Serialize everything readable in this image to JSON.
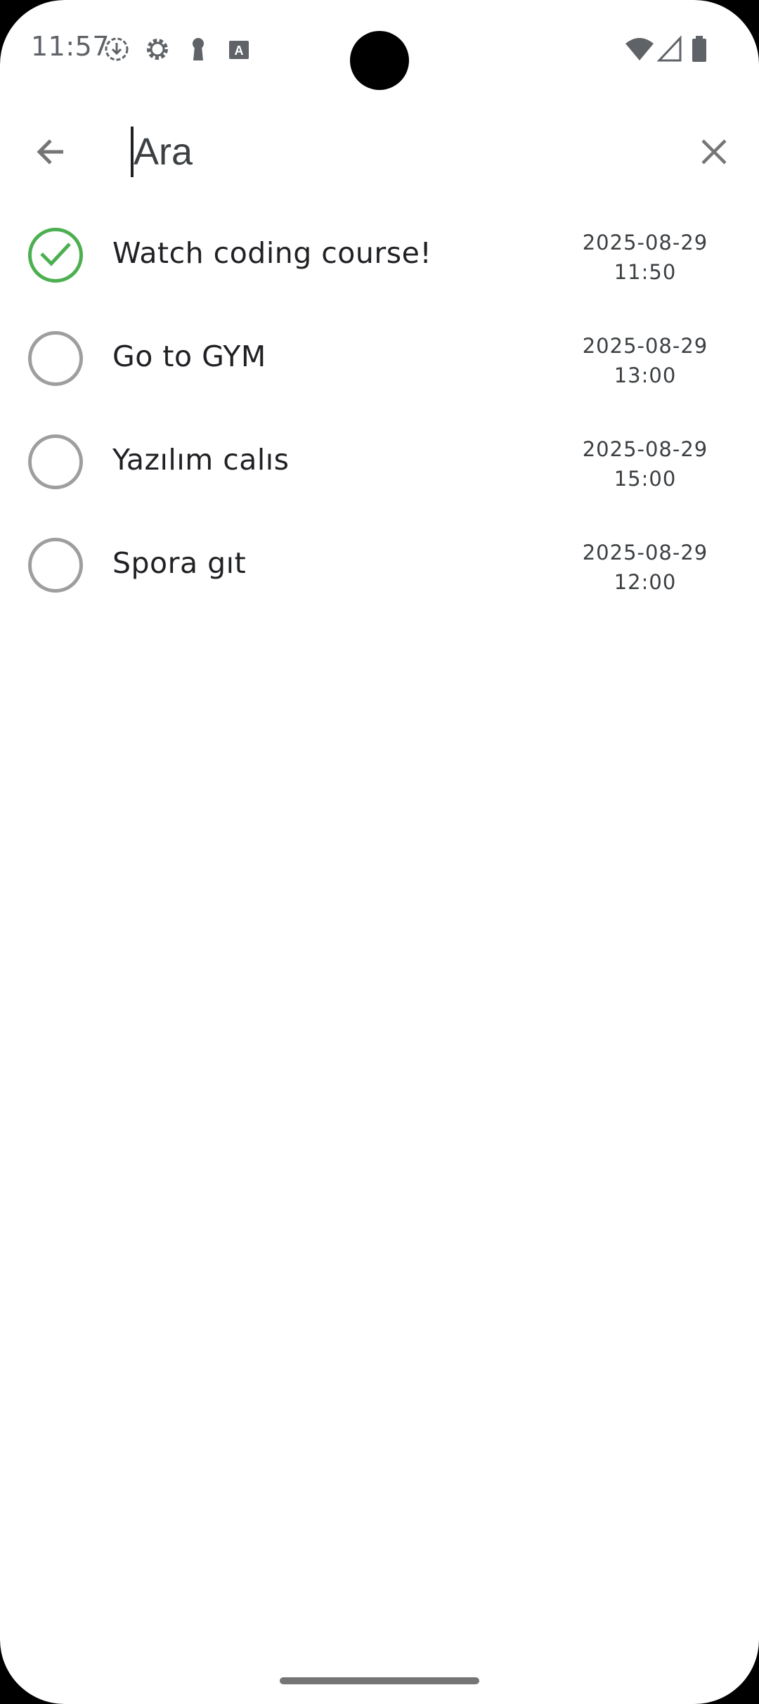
{
  "status_bar": {
    "time": "11:57",
    "icons": [
      "download-circle-icon",
      "settings-gear-icon",
      "keyhole-icon",
      "keyboard-a-icon",
      "wifi-icon",
      "signal-icon",
      "battery-icon"
    ]
  },
  "search": {
    "placeholder": "Ara",
    "value": "",
    "back_icon": "arrow-left-icon",
    "clear_icon": "close-icon"
  },
  "tasks": [
    {
      "title": "Watch coding course!",
      "date": "2025-08-29",
      "time": "11:50",
      "completed": true
    },
    {
      "title": "Go to GYM",
      "date": "2025-08-29",
      "time": "13:00",
      "completed": false
    },
    {
      "title": "Yazılım calıs",
      "date": "2025-08-29",
      "time": "15:00",
      "completed": false
    },
    {
      "title": "Spora gıt",
      "date": "2025-08-29",
      "time": "12:00",
      "completed": false
    }
  ],
  "colors": {
    "completed": "#4caf50",
    "unchecked": "#9e9e9e",
    "text": "#202124",
    "icon": "#757575"
  }
}
